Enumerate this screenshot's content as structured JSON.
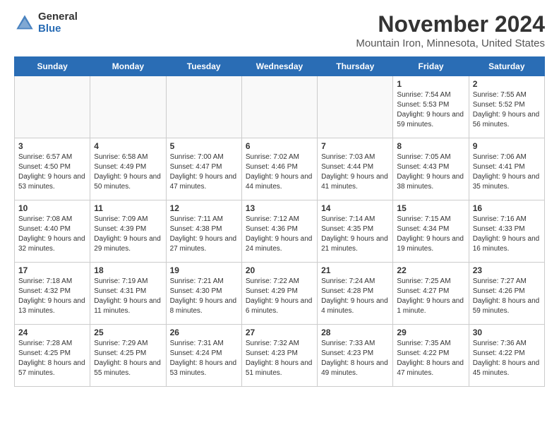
{
  "header": {
    "logo_general": "General",
    "logo_blue": "Blue",
    "month_title": "November 2024",
    "location": "Mountain Iron, Minnesota, United States"
  },
  "weekdays": [
    "Sunday",
    "Monday",
    "Tuesday",
    "Wednesday",
    "Thursday",
    "Friday",
    "Saturday"
  ],
  "weeks": [
    [
      {
        "day": "",
        "info": ""
      },
      {
        "day": "",
        "info": ""
      },
      {
        "day": "",
        "info": ""
      },
      {
        "day": "",
        "info": ""
      },
      {
        "day": "",
        "info": ""
      },
      {
        "day": "1",
        "info": "Sunrise: 7:54 AM\nSunset: 5:53 PM\nDaylight: 9 hours and 59 minutes."
      },
      {
        "day": "2",
        "info": "Sunrise: 7:55 AM\nSunset: 5:52 PM\nDaylight: 9 hours and 56 minutes."
      }
    ],
    [
      {
        "day": "3",
        "info": "Sunrise: 6:57 AM\nSunset: 4:50 PM\nDaylight: 9 hours and 53 minutes."
      },
      {
        "day": "4",
        "info": "Sunrise: 6:58 AM\nSunset: 4:49 PM\nDaylight: 9 hours and 50 minutes."
      },
      {
        "day": "5",
        "info": "Sunrise: 7:00 AM\nSunset: 4:47 PM\nDaylight: 9 hours and 47 minutes."
      },
      {
        "day": "6",
        "info": "Sunrise: 7:02 AM\nSunset: 4:46 PM\nDaylight: 9 hours and 44 minutes."
      },
      {
        "day": "7",
        "info": "Sunrise: 7:03 AM\nSunset: 4:44 PM\nDaylight: 9 hours and 41 minutes."
      },
      {
        "day": "8",
        "info": "Sunrise: 7:05 AM\nSunset: 4:43 PM\nDaylight: 9 hours and 38 minutes."
      },
      {
        "day": "9",
        "info": "Sunrise: 7:06 AM\nSunset: 4:41 PM\nDaylight: 9 hours and 35 minutes."
      }
    ],
    [
      {
        "day": "10",
        "info": "Sunrise: 7:08 AM\nSunset: 4:40 PM\nDaylight: 9 hours and 32 minutes."
      },
      {
        "day": "11",
        "info": "Sunrise: 7:09 AM\nSunset: 4:39 PM\nDaylight: 9 hours and 29 minutes."
      },
      {
        "day": "12",
        "info": "Sunrise: 7:11 AM\nSunset: 4:38 PM\nDaylight: 9 hours and 27 minutes."
      },
      {
        "day": "13",
        "info": "Sunrise: 7:12 AM\nSunset: 4:36 PM\nDaylight: 9 hours and 24 minutes."
      },
      {
        "day": "14",
        "info": "Sunrise: 7:14 AM\nSunset: 4:35 PM\nDaylight: 9 hours and 21 minutes."
      },
      {
        "day": "15",
        "info": "Sunrise: 7:15 AM\nSunset: 4:34 PM\nDaylight: 9 hours and 19 minutes."
      },
      {
        "day": "16",
        "info": "Sunrise: 7:16 AM\nSunset: 4:33 PM\nDaylight: 9 hours and 16 minutes."
      }
    ],
    [
      {
        "day": "17",
        "info": "Sunrise: 7:18 AM\nSunset: 4:32 PM\nDaylight: 9 hours and 13 minutes."
      },
      {
        "day": "18",
        "info": "Sunrise: 7:19 AM\nSunset: 4:31 PM\nDaylight: 9 hours and 11 minutes."
      },
      {
        "day": "19",
        "info": "Sunrise: 7:21 AM\nSunset: 4:30 PM\nDaylight: 9 hours and 8 minutes."
      },
      {
        "day": "20",
        "info": "Sunrise: 7:22 AM\nSunset: 4:29 PM\nDaylight: 9 hours and 6 minutes."
      },
      {
        "day": "21",
        "info": "Sunrise: 7:24 AM\nSunset: 4:28 PM\nDaylight: 9 hours and 4 minutes."
      },
      {
        "day": "22",
        "info": "Sunrise: 7:25 AM\nSunset: 4:27 PM\nDaylight: 9 hours and 1 minute."
      },
      {
        "day": "23",
        "info": "Sunrise: 7:27 AM\nSunset: 4:26 PM\nDaylight: 8 hours and 59 minutes."
      }
    ],
    [
      {
        "day": "24",
        "info": "Sunrise: 7:28 AM\nSunset: 4:25 PM\nDaylight: 8 hours and 57 minutes."
      },
      {
        "day": "25",
        "info": "Sunrise: 7:29 AM\nSunset: 4:25 PM\nDaylight: 8 hours and 55 minutes."
      },
      {
        "day": "26",
        "info": "Sunrise: 7:31 AM\nSunset: 4:24 PM\nDaylight: 8 hours and 53 minutes."
      },
      {
        "day": "27",
        "info": "Sunrise: 7:32 AM\nSunset: 4:23 PM\nDaylight: 8 hours and 51 minutes."
      },
      {
        "day": "28",
        "info": "Sunrise: 7:33 AM\nSunset: 4:23 PM\nDaylight: 8 hours and 49 minutes."
      },
      {
        "day": "29",
        "info": "Sunrise: 7:35 AM\nSunset: 4:22 PM\nDaylight: 8 hours and 47 minutes."
      },
      {
        "day": "30",
        "info": "Sunrise: 7:36 AM\nSunset: 4:22 PM\nDaylight: 8 hours and 45 minutes."
      }
    ]
  ]
}
